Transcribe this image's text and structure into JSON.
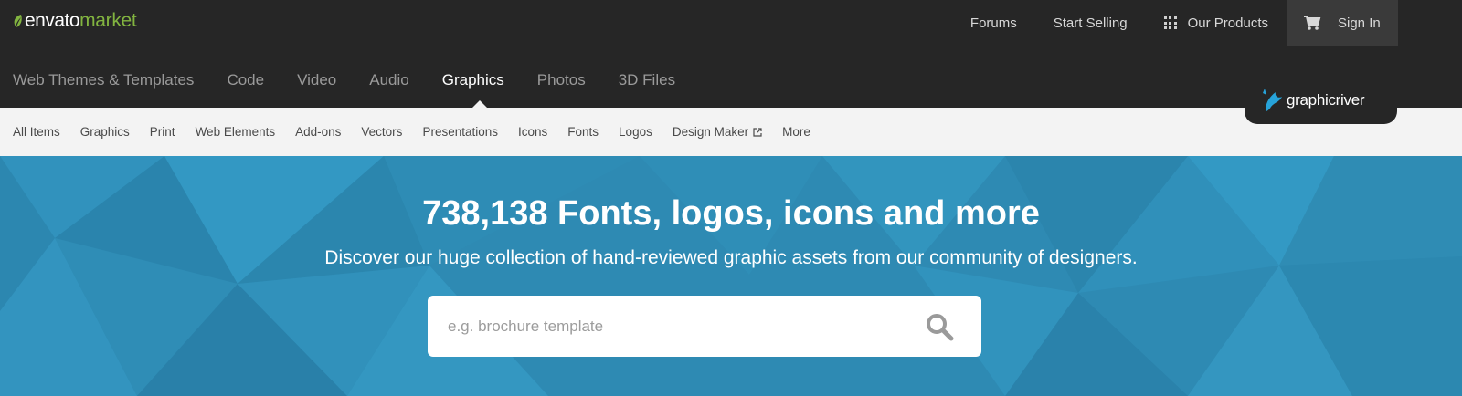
{
  "brand": {
    "word1": "envato",
    "word2": "market",
    "accent": "#82b440"
  },
  "topnav": {
    "forums": "Forums",
    "start_selling": "Start Selling",
    "our_products": "Our Products",
    "sign_in": "Sign In"
  },
  "categories": [
    {
      "label": "Web Themes & Templates",
      "active": false
    },
    {
      "label": "Code",
      "active": false
    },
    {
      "label": "Video",
      "active": false
    },
    {
      "label": "Audio",
      "active": false
    },
    {
      "label": "Graphics",
      "active": true
    },
    {
      "label": "Photos",
      "active": false
    },
    {
      "label": "3D Files",
      "active": false
    }
  ],
  "site_badge": {
    "label": "graphicriver"
  },
  "subnav": [
    "All Items",
    "Graphics",
    "Print",
    "Web Elements",
    "Add-ons",
    "Vectors",
    "Presentations",
    "Icons",
    "Fonts",
    "Logos",
    "Design Maker",
    "More"
  ],
  "hero": {
    "title": "738,138 Fonts, logos, icons and more",
    "subtitle": "Discover our huge collection of hand-reviewed graphic assets from our community of designers.",
    "search_placeholder": "e.g. brochure template",
    "search_value": "",
    "bg_color": "#2e8ab3"
  },
  "icons": {
    "grid": "grid-icon",
    "cart": "cart-icon",
    "external": "external-link-icon",
    "search": "search-icon"
  }
}
